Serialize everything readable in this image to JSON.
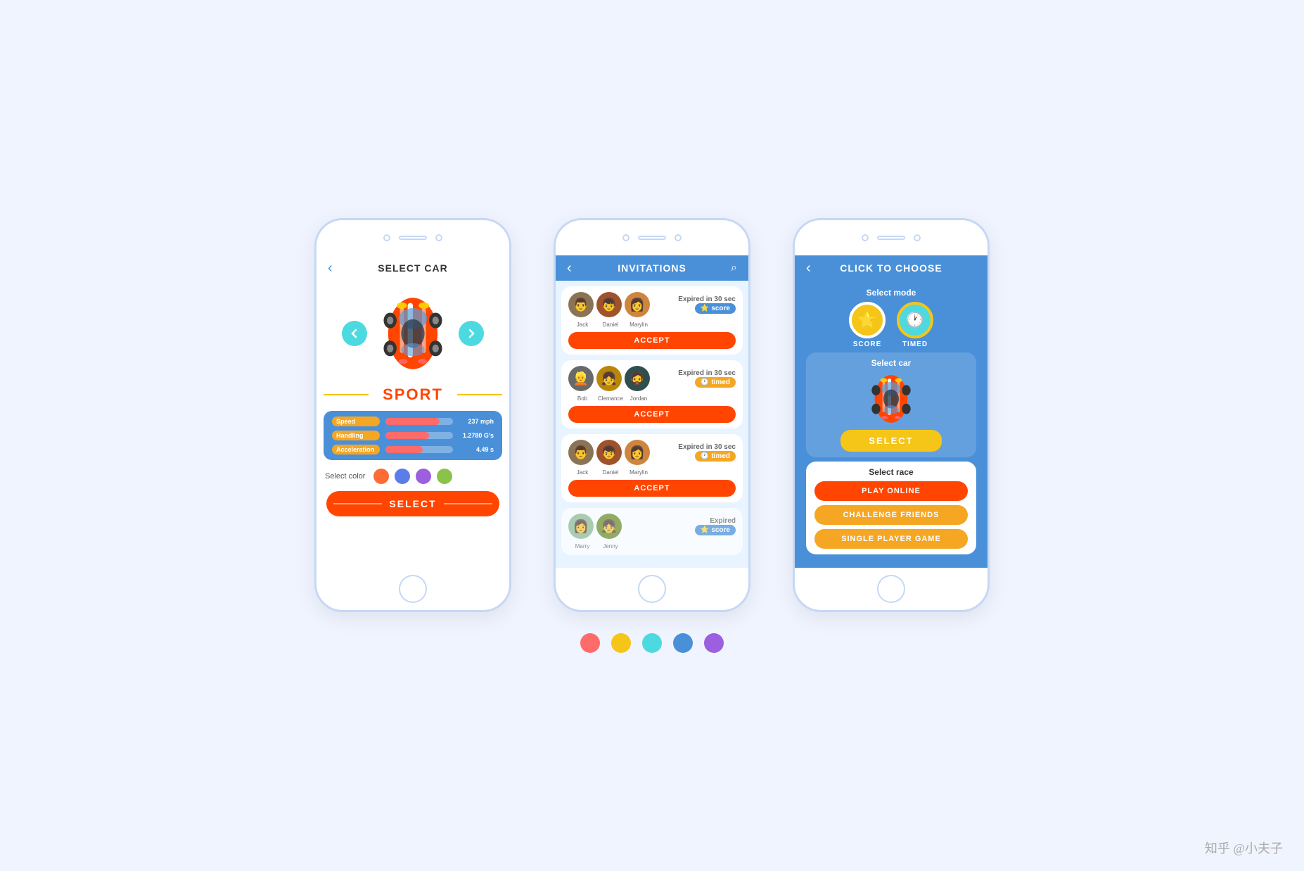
{
  "phone1": {
    "header": {
      "back": "‹",
      "title": "SELECT CAR"
    },
    "car_name": "SPORT",
    "stats": [
      {
        "label": "Speed",
        "value": "237 mph",
        "pct": 80
      },
      {
        "label": "Handling",
        "value": "1.2780 G's",
        "pct": 65
      },
      {
        "label": "Acceleration",
        "value": "4.49 s",
        "pct": 55
      }
    ],
    "color_label": "Select color",
    "colors": [
      "#FF6B35",
      "#5b7de8",
      "#9b5fe0",
      "#8BC34A"
    ],
    "select_btn": "SELECT"
  },
  "phone2": {
    "header": {
      "back": "‹",
      "title": "INVITATIONS",
      "search": "🔍"
    },
    "invitations": [
      {
        "players": [
          "Jack",
          "Daniel",
          "Marylin"
        ],
        "expired": "Expired in 30 sec",
        "badge": "score",
        "accept": "ACCEPT",
        "is_expired": false
      },
      {
        "players": [
          "Bob",
          "Clemance",
          "Jordan"
        ],
        "expired": "Expired in 30 sec",
        "badge": "timed",
        "accept": "ACCEPT",
        "is_expired": false
      },
      {
        "players": [
          "Jack",
          "Daniel",
          "Marylin"
        ],
        "expired": "Expired in 30 sec",
        "badge": "timed",
        "accept": "ACCEPT",
        "is_expired": false
      },
      {
        "players": [
          "Marry",
          "Jenny"
        ],
        "expired": "Expired",
        "badge": "score",
        "accept": null,
        "is_expired": true
      }
    ]
  },
  "phone3": {
    "header": {
      "back": "‹",
      "title": "CLICK TO CHOOSE"
    },
    "select_mode_label": "Select mode",
    "modes": [
      {
        "label": "SCORE",
        "icon": "⭐"
      },
      {
        "label": "TIMED",
        "icon": "🕐"
      }
    ],
    "select_car_label": "Select car",
    "select_btn": "SELECT",
    "select_race_label": "Select race",
    "race_buttons": [
      "PLAY ONLINE",
      "CHALLENGE FRIENDS",
      "SINGLE PLAYER GAME"
    ]
  },
  "bottom_dots": [
    "#FF6B6B",
    "#F5C518",
    "#4DD9E0",
    "#4A90D9",
    "#9B5FE0"
  ],
  "watermark": "知乎 @小夫子"
}
